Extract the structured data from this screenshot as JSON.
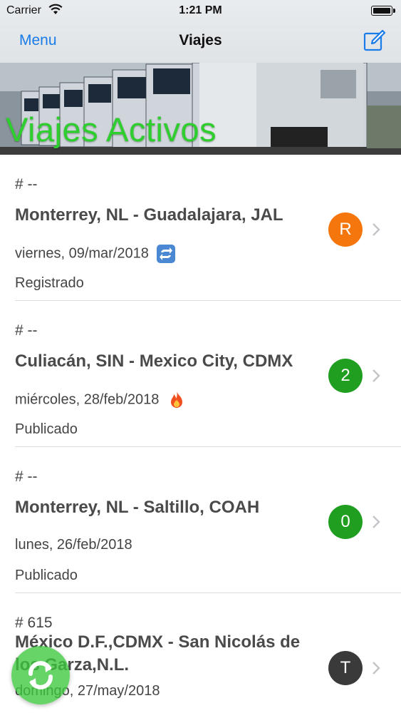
{
  "status_bar": {
    "carrier": "Carrier",
    "time": "1:21 PM"
  },
  "nav": {
    "menu_label": "Menu",
    "title": "Viajes",
    "compose_icon": "compose-icon"
  },
  "banner": {
    "title": "Viajes Activos"
  },
  "colors": {
    "accent": "#1a7ce8",
    "banner_title": "#2fce2f",
    "badge_orange": "#f5760c",
    "badge_green": "#1f9e1f",
    "badge_dark": "#3a3a3a"
  },
  "trips": [
    {
      "number": "# --",
      "route": "Monterrey, NL - Guadalajara, JAL",
      "date": "viernes, 09/mar/2018",
      "emoji": "repeat-icon",
      "status": "Registrado",
      "badge": "R",
      "badge_color": "#f5760c"
    },
    {
      "number": "# --",
      "route": "Culiacán, SIN - Mexico City, CDMX",
      "date": "miércoles, 28/feb/2018",
      "emoji": "fire-icon",
      "status": "Publicado",
      "badge": "2",
      "badge_color": "#1f9e1f"
    },
    {
      "number": "# --",
      "route": "Monterrey, NL - Saltillo, COAH",
      "date": "lunes, 26/feb/2018",
      "emoji": "",
      "status": "Publicado",
      "badge": "0",
      "badge_color": "#1f9e1f"
    },
    {
      "number": "# 615",
      "route": "México D.F.,CDMX - San Nicolás de los Garza,N.L.",
      "date": "domingo, 27/may/2018",
      "emoji": "",
      "status": "",
      "badge": "T",
      "badge_color": "#3a3a3a"
    }
  ],
  "fab": {
    "icon": "refresh-icon"
  }
}
